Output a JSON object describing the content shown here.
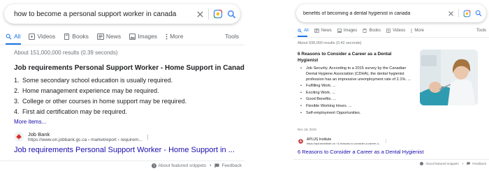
{
  "left": {
    "query": "how to become a personal support worker in canada",
    "tabs": [
      {
        "label": "All",
        "icon": "search-icon",
        "active": true
      },
      {
        "label": "Videos",
        "icon": "play-icon"
      },
      {
        "label": "Books",
        "icon": "book-icon"
      },
      {
        "label": "News",
        "icon": "news-icon"
      },
      {
        "label": "Images",
        "icon": "image-icon"
      },
      {
        "label": "More",
        "icon": "more-vert-icon"
      }
    ],
    "tools_label": "Tools",
    "result_stats": "About 151,000,000 results (0.39 seconds)",
    "snippet_title": "Job requirements Personal Support Worker - Home Support in Canada",
    "steps": [
      {
        "n": "1.",
        "text": "Some secondary school education is usually required."
      },
      {
        "n": "2.",
        "text": "Home management experience may be required."
      },
      {
        "n": "3.",
        "text": "College or other courses in home support may be required."
      },
      {
        "n": "4.",
        "text": "First aid certification may be required."
      }
    ],
    "more_items": "More items...",
    "source_name": "Job Bank",
    "source_url": "https://www.on.jobbank.gc.ca › marketreport › requirem...",
    "result_title": "Job requirements Personal Support Worker - Home Support in ...",
    "footer_snippets": "About featured snippets",
    "footer_feedback": "Feedback"
  },
  "right": {
    "query": "benefits of becoming a dental hygienist in canada",
    "tabs": [
      {
        "label": "All",
        "icon": "search-icon",
        "active": true
      },
      {
        "label": "News",
        "icon": "news-icon"
      },
      {
        "label": "Images",
        "icon": "image-icon"
      },
      {
        "label": "Books",
        "icon": "book-icon"
      },
      {
        "label": "Videos",
        "icon": "play-icon"
      },
      {
        "label": "More",
        "icon": "more-vert-icon"
      }
    ],
    "tools_label": "Tools",
    "result_stats": "About 939,000 results (0.42 seconds)",
    "snippet_title": "6 Reasons to Consider a Career as a Dental Hygienist",
    "bullets": [
      "Job Security. According to a 2015 survey by the Canadian Dental Hygiene Association (CDHA), the dental hygienist profession has an impressive unemployment rate of 2.1%. ...",
      "Fulfilling Work. ...",
      "Exciting Work. ...",
      "Good Benefits. ...",
      "Flexible Working Hours. ...",
      "Self-employment Opportunities."
    ],
    "date": "Dec 18, 2019",
    "source_name": "APLUS Institute",
    "source_url": "https://aplusinstitute.ca › 6-reasons-to-consider-a-career-o...",
    "result_title": "6 Reasons to Consider a Career as a Dental Hygienist",
    "footer_snippets": "About featured snippets",
    "footer_feedback": "Feedback"
  },
  "colors": {
    "link": "#1a0dab",
    "accent": "#1a73e8",
    "text": "#202124",
    "muted": "#70757a"
  }
}
